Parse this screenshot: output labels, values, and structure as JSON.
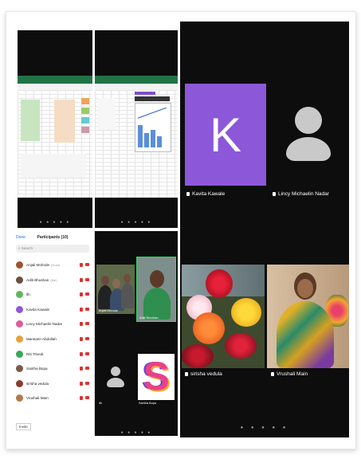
{
  "participants_panel": {
    "done": "Done",
    "title": "Participants (10)",
    "search_placeholder": "Search",
    "footer": "Invite",
    "items": [
      {
        "name": "Anjali Mohnde",
        "tag": "(Host)",
        "color": "#a0522d"
      },
      {
        "name": "Aditi Bhushan",
        "tag": "(Me)",
        "color": "#6b4f3f"
      },
      {
        "name": "lth",
        "tag": "",
        "color": "#5cb85c"
      },
      {
        "name": "Kavita Kawale",
        "tag": "",
        "color": "#8c58d9"
      },
      {
        "name": "Lincy Michaelin Nadar",
        "tag": "",
        "color": "#e05a9c"
      },
      {
        "name": "Mansarin Abdullah",
        "tag": "",
        "color": "#e6a23c"
      },
      {
        "name": "Riti Trivedi",
        "tag": "",
        "color": "#34a853"
      },
      {
        "name": "Saritha Bupa",
        "tag": "",
        "color": "#7a5a48"
      },
      {
        "name": "sirisha vedula",
        "tag": "",
        "color": "#8a3b2e"
      },
      {
        "name": "Vrushali Main",
        "tag": "",
        "color": "#b07a48"
      }
    ]
  },
  "mini_gallery": {
    "tiles": [
      {
        "name": "Anjali Mohnde"
      },
      {
        "name": "Aditi Bhushan"
      },
      {
        "name": "lth"
      },
      {
        "name": "Saritha Bupa"
      }
    ],
    "s_logo": "S"
  },
  "video_tiles": {
    "kavita": {
      "initial": "K",
      "name": "Kavita Kawale",
      "color": "#8c58d9"
    },
    "lincy": {
      "name": "Lincy Michaelin Nadar"
    },
    "sirisha": {
      "name": "sirisha vedula"
    },
    "vrushali": {
      "name": "Vrushali Main"
    }
  },
  "pager": {
    "dots": "● ● ● ● ●"
  },
  "colors": {
    "excel_green": "#217346",
    "tile_bg": "#0d0d0d",
    "mute_red": "#dd3333"
  }
}
